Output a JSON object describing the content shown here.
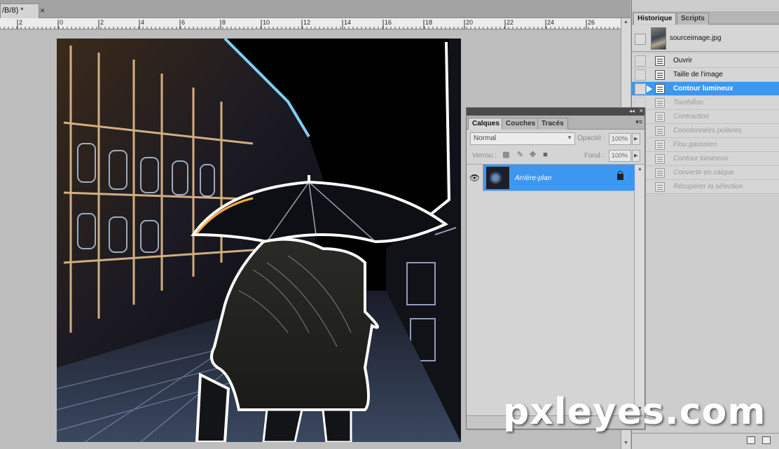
{
  "document": {
    "tab_title": "/B/8) *",
    "close_glyph": "×"
  },
  "ruler": {
    "labels": [
      "2",
      "0",
      "2",
      "4",
      "6",
      "8",
      "10",
      "12",
      "14",
      "16",
      "18",
      "20",
      "22",
      "24",
      "26"
    ]
  },
  "history_panel": {
    "tabs": [
      "Historique",
      "Scripts"
    ],
    "active_tab": "Historique",
    "snapshot_label": "sourceimage.jpg",
    "items": [
      {
        "label": "Ouvrir",
        "state": "normal"
      },
      {
        "label": "Taille de l'image",
        "state": "normal"
      },
      {
        "label": "Contour lumineux",
        "state": "selected"
      },
      {
        "label": "Tourbillon",
        "state": "greyed"
      },
      {
        "label": "Contraction",
        "state": "greyed"
      },
      {
        "label": "Coordonnées polaires",
        "state": "greyed"
      },
      {
        "label": "Flou gaussien",
        "state": "greyed"
      },
      {
        "label": "Contour lumineux",
        "state": "greyed"
      },
      {
        "label": "Convertir en calque",
        "state": "greyed"
      },
      {
        "label": "Récupérer la sélection",
        "state": "greyed"
      }
    ]
  },
  "layers_panel": {
    "tabs": [
      "Calques",
      "Couches",
      "Tracés"
    ],
    "active_tab": "Calques",
    "blend_mode": "Normal",
    "opacity_label": "Opacité :",
    "opacity_value": "100%",
    "lock_label": "Verrou :",
    "fill_label": "Fond :",
    "fill_value": "100%",
    "layers": [
      {
        "name": "Arrière-plan",
        "visible": true,
        "locked": true,
        "selected": true
      }
    ]
  },
  "watermark": "pxleyes.com",
  "colors": {
    "selection": "#3d97f0",
    "panel_bg": "#d4d4d4",
    "canvas_bg": "#bdbdbd"
  }
}
